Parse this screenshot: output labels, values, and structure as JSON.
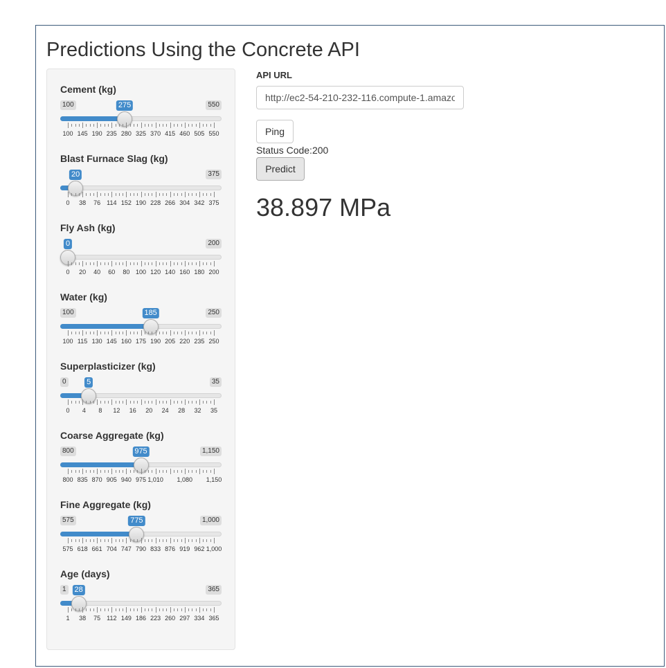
{
  "page": {
    "title": "Predictions Using the Concrete API"
  },
  "sliders": [
    {
      "label": "Cement (kg)",
      "min_label": "100",
      "max_label": "550",
      "value_label": "275",
      "fraction": 0.389,
      "ticks": [
        "100",
        "145",
        "190",
        "235",
        "280",
        "325",
        "370",
        "415",
        "460",
        "505",
        "550"
      ]
    },
    {
      "label": "Blast Furnace Slag (kg)",
      "min_label": "",
      "max_label": "375",
      "value_label": "20",
      "fraction": 0.053,
      "ticks": [
        "0",
        "38",
        "76",
        "114",
        "152",
        "190",
        "228",
        "266",
        "304",
        "342",
        "375"
      ]
    },
    {
      "label": "Fly Ash (kg)",
      "min_label": "",
      "max_label": "200",
      "value_label": "0",
      "fraction": 0.0,
      "ticks": [
        "0",
        "20",
        "40",
        "60",
        "80",
        "100",
        "120",
        "140",
        "160",
        "180",
        "200"
      ]
    },
    {
      "label": "Water (kg)",
      "min_label": "100",
      "max_label": "250",
      "value_label": "185",
      "fraction": 0.567,
      "ticks": [
        "100",
        "115",
        "130",
        "145",
        "160",
        "175",
        "190",
        "205",
        "220",
        "235",
        "250"
      ]
    },
    {
      "label": "Superplasticizer (kg)",
      "min_label": "0",
      "max_label": "35",
      "value_label": "5",
      "fraction": 0.143,
      "ticks": [
        "0",
        "4",
        "8",
        "12",
        "16",
        "20",
        "24",
        "28",
        "32",
        "35"
      ]
    },
    {
      "label": "Coarse Aggregate (kg)",
      "min_label": "800",
      "max_label": "1,150",
      "value_label": "975",
      "fraction": 0.5,
      "ticks": [
        "800",
        "835",
        "870",
        "905",
        "940",
        "975",
        "1,010",
        "",
        "1,080",
        "",
        "1,150"
      ]
    },
    {
      "label": "Fine Aggregate (kg)",
      "min_label": "575",
      "max_label": "1,000",
      "value_label": "775",
      "fraction": 0.471,
      "ticks": [
        "575",
        "618",
        "661",
        "704",
        "747",
        "790",
        "833",
        "876",
        "919",
        "962",
        "1,000"
      ]
    },
    {
      "label": "Age (days)",
      "min_label": "1",
      "max_label": "365",
      "value_label": "28",
      "fraction": 0.074,
      "ticks": [
        "1",
        "38",
        "75",
        "112",
        "149",
        "186",
        "223",
        "260",
        "297",
        "334",
        "365"
      ]
    }
  ],
  "api": {
    "label": "API URL",
    "url_value": "http://ec2-54-210-232-116.compute-1.amazo"
  },
  "buttons": {
    "ping": "Ping",
    "predict": "Predict"
  },
  "status_text": "Status Code:200",
  "result_text": "38.897 MPa",
  "colors": {
    "accent": "#428bca",
    "panel_bg": "#f5f5f5"
  }
}
